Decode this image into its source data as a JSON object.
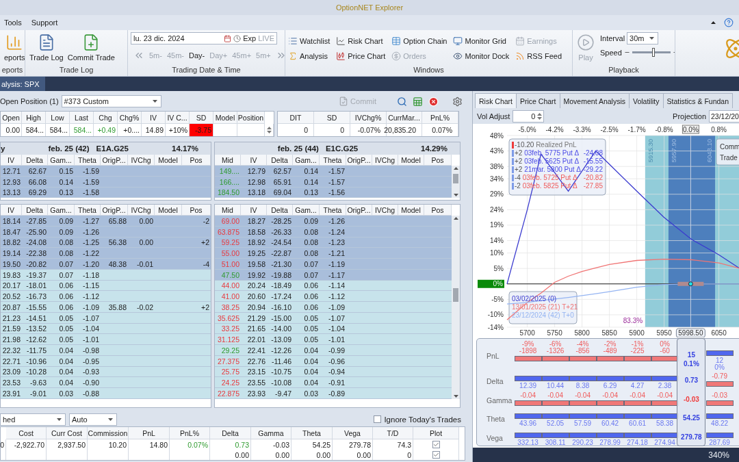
{
  "window": {
    "title": "OptionNET Explorer"
  },
  "menu": [
    "Tools",
    "Support"
  ],
  "ribbon": {
    "groups": [
      {
        "kind": "large_buttons",
        "caption": "eports",
        "buttons": [
          "eports"
        ]
      },
      {
        "kind": "large_buttons",
        "caption": "Trade Log",
        "buttons": [
          "Trade Log",
          "Commit Trade"
        ]
      },
      {
        "kind": "date_time",
        "caption": "Trading Date & Time",
        "date": "lu. 23 dic. 2024",
        "exp": "Exp",
        "live": "LIVE",
        "steps": [
          {
            "label": "5m-",
            "enabled": false
          },
          {
            "label": "45m-",
            "enabled": false
          },
          {
            "label": "Day-",
            "enabled": true
          },
          {
            "label": "Day+",
            "enabled": false
          },
          {
            "label": "45m+",
            "enabled": false
          },
          {
            "label": "5m+",
            "enabled": false
          }
        ]
      },
      {
        "kind": "windows",
        "caption": "Windows",
        "items": [
          {
            "label": "Watchlist",
            "enabled": true
          },
          {
            "label": "Analysis",
            "enabled": true
          },
          {
            "label": "Risk Chart",
            "enabled": true
          },
          {
            "label": "Price Chart",
            "enabled": true
          },
          {
            "label": "Option Chain",
            "enabled": true
          },
          {
            "label": "Orders",
            "enabled": false
          },
          {
            "label": "Monitor Grid",
            "enabled": true
          },
          {
            "label": "Monitor Dock",
            "enabled": true
          },
          {
            "label": "Earnings",
            "enabled": false
          },
          {
            "label": "RSS Feed",
            "enabled": true
          }
        ]
      },
      {
        "kind": "playback",
        "caption": "Playback",
        "play": {
          "label": "Play",
          "enabled": false
        },
        "interval": {
          "label": "Interval",
          "value": "30m"
        },
        "speed": {
          "label": "Speed",
          "level": 0.55
        }
      }
    ]
  },
  "doc_tabs": [
    {
      "label": "alysis: SPX",
      "selected": true
    }
  ],
  "position_panel": {
    "label": "Open Position (1)",
    "position_select": "#373 Custom",
    "commit": {
      "label": "Commit",
      "enabled": false
    }
  },
  "quote": {
    "columns": [
      {
        "label": "Open",
        "value": "0.00",
        "up": false,
        "alert": false
      },
      {
        "label": "High",
        "value": "584...",
        "up": false,
        "alert": false
      },
      {
        "label": "Low",
        "value": "584...",
        "up": false,
        "alert": false
      },
      {
        "label": "Last",
        "value": "584...",
        "up": true,
        "alert": false
      },
      {
        "label": "Chg",
        "value": "+0.49",
        "up": true,
        "alert": false
      },
      {
        "label": "Chg%",
        "value": "+0....",
        "up": false,
        "alert": false
      },
      {
        "label": "IV",
        "value": "14.89",
        "up": false,
        "alert": false
      },
      {
        "label": "IV C...",
        "value": "+10%",
        "up": false,
        "alert": false
      },
      {
        "label": "SD",
        "value": "-3.75",
        "up": false,
        "alert": true
      },
      {
        "label": "Model"
      },
      {
        "label": "Position"
      }
    ]
  },
  "summary": {
    "columns": [
      {
        "label": "DIT",
        "value": "0"
      },
      {
        "label": "SD",
        "value": "0"
      },
      {
        "label": "IVChg%",
        "value": "-0.07%"
      },
      {
        "label": "CurrMar...",
        "value": "20,835.20"
      },
      {
        "label": "PnL%",
        "value": "0.07%"
      }
    ]
  },
  "chain_top": {
    "left": {
      "group": {
        "lead": "y",
        "expiry": "feb. 25 (42)",
        "symbol": "E1A.G25",
        "iv": "14.17%"
      },
      "columns": [
        "IV",
        "Delta",
        "Gam...",
        "Theta",
        "OrigP...",
        "IVChg",
        "Model",
        "Pos"
      ],
      "rows": [
        {
          "shaded": true,
          "cells": [
            "12.71",
            "62.67",
            "0.15",
            "-1.59"
          ]
        },
        {
          "shaded": true,
          "cells": [
            "12.93",
            "66.08",
            "0.14",
            "-1.59"
          ]
        },
        {
          "shaded": true,
          "cells": [
            "13.13",
            "69.29",
            "0.13",
            "-1.58"
          ]
        }
      ]
    },
    "right": {
      "group": {
        "expiry": "feb. 25 (44)",
        "symbol": "E1C.G25",
        "iv": "14.29%"
      },
      "columns": [
        "Mid",
        "IV",
        "Delta",
        "Gam...",
        "Theta",
        "OrigP...",
        "IVChg",
        "Model",
        "Pos"
      ],
      "rows": [
        {
          "shaded": true,
          "mid_up": true,
          "cells": [
            "149....",
            "12.79",
            "62.57",
            "0.14",
            "-1.57"
          ]
        },
        {
          "shaded": true,
          "mid_up": true,
          "cells": [
            "166....",
            "12.98",
            "65.91",
            "0.14",
            "-1.57"
          ]
        },
        {
          "shaded": true,
          "mid_up": true,
          "cells": [
            "184.50",
            "13.18",
            "69.04",
            "0.13",
            "-1.56"
          ]
        }
      ]
    }
  },
  "chain_bottom": {
    "left": {
      "columns": [
        "IV",
        "Delta",
        "Gam...",
        "Theta",
        "OrigP...",
        "IVChg",
        "Model",
        "Pos"
      ],
      "rows": [
        {
          "shaded": true,
          "cells": [
            "18.14",
            "-27.85",
            "0.09",
            "-1.27",
            "65.88",
            "0.00",
            null,
            "-2"
          ]
        },
        {
          "shaded": true,
          "cells": [
            "18.47",
            "-25.90",
            "0.09",
            "-1.26"
          ]
        },
        {
          "shaded": true,
          "cells": [
            "18.82",
            "-24.08",
            "0.08",
            "-1.25",
            "56.38",
            "0.00",
            null,
            "+2"
          ]
        },
        {
          "shaded": true,
          "cells": [
            "19.14",
            "-22.38",
            "0.08",
            "-1.22"
          ]
        },
        {
          "shaded": true,
          "cells": [
            "19.50",
            "-20.82",
            "0.07",
            "-1.20",
            "48.38",
            "-0.01",
            null,
            "-4"
          ]
        },
        {
          "shaded": false,
          "cells": [
            "19.83",
            "-19.37",
            "0.07",
            "-1.18"
          ]
        },
        {
          "shaded": false,
          "cells": [
            "20.17",
            "-18.01",
            "0.06",
            "-1.15"
          ]
        },
        {
          "shaded": false,
          "cells": [
            "20.52",
            "-16.73",
            "0.06",
            "-1.12"
          ]
        },
        {
          "shaded": false,
          "cells": [
            "20.87",
            "-15.55",
            "0.06",
            "-1.09",
            "35.88",
            "-0.02",
            null,
            "+2"
          ]
        },
        {
          "shaded": false,
          "cells": [
            "21.23",
            "-14.51",
            "0.05",
            "-1.07"
          ]
        },
        {
          "shaded": false,
          "cells": [
            "21.59",
            "-13.52",
            "0.05",
            "-1.04"
          ]
        },
        {
          "shaded": false,
          "cells": [
            "21.98",
            "-12.62",
            "0.05",
            "-1.01"
          ]
        },
        {
          "shaded": false,
          "cells": [
            "22.32",
            "-11.75",
            "0.04",
            "-0.98"
          ]
        },
        {
          "shaded": false,
          "cells": [
            "22.71",
            "-10.96",
            "0.04",
            "-0.95"
          ]
        },
        {
          "shaded": false,
          "cells": [
            "23.09",
            "-10.28",
            "0.04",
            "-0.93"
          ]
        },
        {
          "shaded": false,
          "cells": [
            "23.53",
            "-9.63",
            "0.04",
            "-0.90"
          ]
        },
        {
          "shaded": false,
          "cells": [
            "23.91",
            "-9.01",
            "0.03",
            "-0.88"
          ]
        }
      ]
    },
    "right": {
      "columns": [
        "Mid",
        "IV",
        "Delta",
        "Gam...",
        "Theta",
        "OrigP...",
        "IVChg",
        "Model",
        "Pos"
      ],
      "rows": [
        {
          "shaded": true,
          "mid_up": false,
          "cells": [
            "69.00",
            "18.27",
            "-28.25",
            "0.09",
            "-1.26"
          ]
        },
        {
          "shaded": true,
          "mid_up": false,
          "cells": [
            "63.875",
            "18.58",
            "-26.33",
            "0.08",
            "-1.24"
          ]
        },
        {
          "shaded": true,
          "mid_up": false,
          "cells": [
            "59.25",
            "18.92",
            "-24.54",
            "0.08",
            "-1.23"
          ]
        },
        {
          "shaded": true,
          "mid_up": false,
          "cells": [
            "55.00",
            "19.25",
            "-22.87",
            "0.08",
            "-1.21"
          ]
        },
        {
          "shaded": true,
          "mid_up": false,
          "cells": [
            "51.00",
            "19.58",
            "-21.30",
            "0.07",
            "-1.19"
          ]
        },
        {
          "shaded": true,
          "mid_up": true,
          "cells": [
            "47.50",
            "19.92",
            "-19.88",
            "0.07",
            "-1.17"
          ]
        },
        {
          "shaded": false,
          "mid_up": false,
          "cells": [
            "44.00",
            "20.24",
            "-18.49",
            "0.06",
            "-1.14"
          ]
        },
        {
          "shaded": false,
          "mid_up": false,
          "cells": [
            "41.00",
            "20.60",
            "-17.24",
            "0.06",
            "-1.12"
          ]
        },
        {
          "shaded": false,
          "mid_up": false,
          "cells": [
            "38.25",
            "20.94",
            "-16.10",
            "0.06",
            "-1.09"
          ]
        },
        {
          "shaded": false,
          "mid_up": false,
          "cells": [
            "35.625",
            "21.29",
            "-15.00",
            "0.05",
            "-1.07"
          ]
        },
        {
          "shaded": false,
          "mid_up": false,
          "cells": [
            "33.25",
            "21.65",
            "-14.00",
            "0.05",
            "-1.04"
          ]
        },
        {
          "shaded": false,
          "mid_up": false,
          "cells": [
            "31.125",
            "22.01",
            "-13.09",
            "0.05",
            "-1.01"
          ]
        },
        {
          "shaded": false,
          "mid_up": true,
          "cells": [
            "29.25",
            "22.41",
            "-12.26",
            "0.04",
            "-0.99"
          ]
        },
        {
          "shaded": false,
          "mid_up": false,
          "cells": [
            "27.375",
            "22.76",
            "-11.46",
            "0.04",
            "-0.96"
          ]
        },
        {
          "shaded": false,
          "mid_up": false,
          "cells": [
            "25.75",
            "23.15",
            "-10.75",
            "0.04",
            "-0.94"
          ]
        },
        {
          "shaded": false,
          "mid_up": false,
          "cells": [
            "24.25",
            "23.55",
            "-10.08",
            "0.04",
            "-0.91"
          ]
        },
        {
          "shaded": false,
          "mid_up": false,
          "cells": [
            "22.875",
            "23.93",
            "-9.47",
            "0.03",
            "-0.89"
          ]
        }
      ]
    }
  },
  "filters": {
    "mode": "hed",
    "scale": "Auto",
    "ignore_todays_trades": {
      "label": "Ignore Today's Trades",
      "checked": false
    }
  },
  "positions": {
    "columns": [
      "",
      "Cost",
      "Curr Cost",
      "Commission",
      "PnL",
      "PnL%",
      "Delta",
      "Gamma",
      "Theta",
      "Vega",
      "T/D",
      "Plot"
    ],
    "rows": [
      {
        "gain": true,
        "plot": true,
        "cells": [
          "0",
          "-2,922.70",
          "2,937.50",
          "10.20",
          "14.80",
          "0.07%",
          "0.73",
          "-0.03",
          "54.25",
          "279.78",
          "74.3"
        ]
      },
      {
        "plot": true,
        "cells": [
          null,
          null,
          null,
          null,
          null,
          null,
          "0.00",
          "0.00",
          "0.00",
          "0.00",
          "0"
        ]
      }
    ]
  },
  "analysis": {
    "tabs": [
      {
        "label": "Risk Chart",
        "selected": true
      },
      {
        "label": "Price Chart",
        "selected": false
      },
      {
        "label": "Movement Analysis",
        "selected": false
      },
      {
        "label": "Volatility",
        "selected": false
      },
      {
        "label": "Statistics & Fundan",
        "selected": false
      }
    ],
    "vol_adjust": {
      "label": "Vol Adjust",
      "value": "0"
    },
    "projection": {
      "label": "Projection",
      "value": "23/12/20"
    },
    "risk_chart": {
      "chart_data": {
        "type": "line",
        "xlim": [
          5663,
          6088
        ],
        "ylim": [
          -14,
          48
        ],
        "grid": true,
        "xticks": [
          5700,
          5750,
          5800,
          5850,
          5900,
          5950,
          6050
        ],
        "yticks": [
          {
            "value": 48,
            "label": "48%"
          },
          {
            "value": 43,
            "label": "43%"
          },
          {
            "value": 38,
            "label": "38%"
          },
          {
            "value": 34,
            "label": "34%"
          },
          {
            "value": 29,
            "label": "29%"
          },
          {
            "value": 24,
            "label": "24%"
          },
          {
            "value": 19,
            "label": "19%"
          },
          {
            "value": 14,
            "label": "14%"
          },
          {
            "value": 10,
            "label": "10%"
          },
          {
            "value": 5,
            "label": "5%"
          },
          {
            "value": 0,
            "label": "0%"
          },
          {
            "value": -5,
            "label": "-5%"
          },
          {
            "value": -10,
            "label": "-10%"
          },
          {
            "value": -14,
            "label": "-14%"
          }
        ],
        "x": [
          5663,
          5700,
          5725,
          5750,
          5775,
          5800,
          5825,
          5850,
          5900,
          5950,
          6000,
          6050,
          6088
        ],
        "series": [
          {
            "name": "03/02/2025 (0)",
            "color": "#3b3bcf",
            "values": [
              0,
              24,
              42,
              36,
              30,
              36.5,
              43,
              38.7,
              30,
              21.5,
              14.4,
              9.4,
              5
            ]
          },
          {
            "name": "13/01/2025 (21) T+21",
            "color": "#f07474",
            "values": [
              -11.6,
              -6,
              -3,
              0.5,
              2.5,
              4,
              5.2,
              6.3,
              7.6,
              8,
              7.8,
              6.8,
              5
            ]
          },
          {
            "name": "23/12/2024 (42) T+0",
            "color": "#94b4f2",
            "values": [
              -6.5,
              -6,
              -5.4,
              -4.9,
              -4.4,
              -3.8,
              -3.2,
              -2.5,
              -1.1,
              -0.2,
              0,
              0,
              0
            ]
          }
        ],
        "bands": [
          {
            "axis": "x",
            "from": 5915.3,
            "to": 6088,
            "color": "#92ccd9",
            "label": "5915.30"
          },
          {
            "axis": "x",
            "from": 5957.9,
            "to": 6043.1,
            "color": "#4d7fbd",
            "label": "5957.90"
          }
        ],
        "ref_lines": [
          {
            "axis": "x",
            "value": 5998.5,
            "label": "5998.50"
          }
        ],
        "annotations": [
          "83.3%"
        ]
      },
      "top_axis": [
        "-5.0%",
        "-4.2%",
        "-3.3%",
        "-2.5%",
        "-1.7%",
        "-0.8%",
        "0.8%"
      ],
      "current_pct": "0.0%",
      "band_end_label": "6043.10",
      "legend": [
        {
          "kind": "realized",
          "qty": "-10.20",
          "text": "Realized PnL"
        },
        {
          "kind": "long",
          "qty": "+2",
          "text": "03feb. 5775 Put Δ",
          "delta": "-24.08"
        },
        {
          "kind": "long",
          "qty": "+2",
          "text": "03feb. 5625 Put Δ",
          "delta": "-15.55"
        },
        {
          "kind": "long",
          "qty": "+2",
          "text": "21mar. 5800 Put Δ",
          "delta": "-29.22"
        },
        {
          "kind": "short",
          "qty": "-4",
          "text": "03feb. 5725 Put Δ",
          "delta": "-20.82"
        },
        {
          "kind": "short",
          "qty": "-2",
          "text": "03feb. 5825 Put Δ",
          "delta": "-27.85"
        }
      ],
      "tooltip": [
        "Comm",
        "Trade"
      ]
    },
    "greeks": {
      "rows": [
        {
          "label": "PnL",
          "cells": [
            {
              "kind": "negative",
              "values": [
                "-9%",
                "-1898"
              ]
            },
            {
              "kind": "negative",
              "values": [
                "-6%",
                "-1326"
              ]
            },
            {
              "kind": "negative",
              "values": [
                "-4%",
                "-856"
              ]
            },
            {
              "kind": "negative",
              "values": [
                "-2%",
                "-489"
              ]
            },
            {
              "kind": "negative",
              "values": [
                "-1%",
                "-225"
              ]
            },
            {
              "kind": "negative",
              "values": [
                "0%",
                "-60"
              ]
            },
            {
              "kind": "positive",
              "values": [
                "12",
                "0%"
              ]
            }
          ],
          "current": {
            "kind": "positive",
            "values": [
              "15",
              "0.1%"
            ]
          }
        },
        {
          "label": "Delta",
          "cells": [
            {
              "kind": "positive",
              "values": [
                "12.39"
              ]
            },
            {
              "kind": "positive",
              "values": [
                "10.44"
              ]
            },
            {
              "kind": "positive",
              "values": [
                "8.38"
              ]
            },
            {
              "kind": "positive",
              "values": [
                "6.29"
              ]
            },
            {
              "kind": "positive",
              "values": [
                "4.27"
              ]
            },
            {
              "kind": "positive",
              "values": [
                "2.38"
              ]
            },
            {
              "kind": "negative",
              "values": [
                "-0.79"
              ]
            }
          ],
          "current": {
            "kind": "positive",
            "values": [
              "0.73"
            ]
          }
        },
        {
          "label": "Gamma",
          "cells": [
            {
              "kind": "negative",
              "values": [
                "-0.04"
              ]
            },
            {
              "kind": "negative",
              "values": [
                "-0.04"
              ]
            },
            {
              "kind": "negative",
              "values": [
                "-0.04"
              ]
            },
            {
              "kind": "negative",
              "values": [
                "-0.04"
              ]
            },
            {
              "kind": "negative",
              "values": [
                "-0.04"
              ]
            },
            {
              "kind": "negative",
              "values": [
                "-0.04"
              ]
            },
            {
              "kind": "negative",
              "values": [
                "-0.03"
              ]
            }
          ],
          "current": {
            "kind": "negative",
            "values": [
              "-0.03"
            ]
          }
        },
        {
          "label": "Theta",
          "cells": [
            {
              "kind": "positive",
              "values": [
                "43.96"
              ]
            },
            {
              "kind": "positive",
              "values": [
                "52.05"
              ]
            },
            {
              "kind": "positive",
              "values": [
                "57.59"
              ]
            },
            {
              "kind": "positive",
              "values": [
                "60.42"
              ]
            },
            {
              "kind": "positive",
              "values": [
                "60.61"
              ]
            },
            {
              "kind": "positive",
              "values": [
                "58.38"
              ]
            },
            {
              "kind": "positive",
              "values": [
                "48.22"
              ]
            }
          ],
          "current": {
            "kind": "positive",
            "values": [
              "54.25"
            ]
          }
        },
        {
          "label": "Vega",
          "cells": [
            {
              "kind": "positive",
              "values": [
                "332.13"
              ]
            },
            {
              "kind": "positive",
              "values": [
                "308.11"
              ]
            },
            {
              "kind": "positive",
              "values": [
                "290.23"
              ]
            },
            {
              "kind": "positive",
              "values": [
                "278.99"
              ]
            },
            {
              "kind": "positive",
              "values": [
                "274.18"
              ]
            },
            {
              "kind": "positive",
              "values": [
                "274.94"
              ]
            },
            {
              "kind": "positive",
              "values": [
                "287.69"
              ]
            }
          ],
          "current": {
            "kind": "positive",
            "values": [
              "279.78"
            ]
          }
        }
      ]
    },
    "status": {
      "zoom": "340%"
    }
  }
}
